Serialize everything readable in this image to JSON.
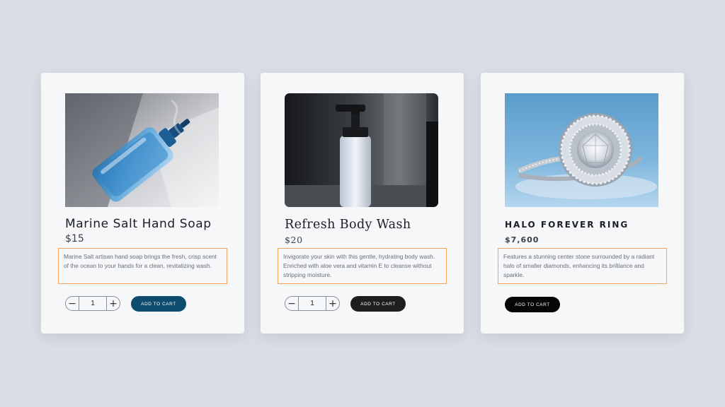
{
  "colors": {
    "page_bg": "#d9dde4",
    "card_bg": "#f6f7f9",
    "highlight_border": "#f0a35b",
    "soap_button": "#0e4c6e",
    "body_wash_button": "#1e1e1e",
    "ring_button": "#060606"
  },
  "products": [
    {
      "title": "Marine Salt Hand Soap",
      "price": "$15",
      "description": "Marine Salt artisan hand soap brings the fresh, crisp scent of the ocean to your hands for a clean, revitalizing wash.",
      "quantity": "1",
      "minus_label": "−",
      "plus_label": "+",
      "button_label": "ADD TO CART",
      "image_icon": "hand-soap-bottle-photo"
    },
    {
      "title": "Refresh Body Wash",
      "price": "$20",
      "description": "Invigorate your skin with this gentle, hydrating body wash. Enriched with aloe vera and vitamin E to cleanse without stripping moisture.",
      "quantity": "1",
      "minus_label": "−",
      "plus_label": "+",
      "button_label": "ADD TO CART",
      "image_icon": "pump-bottle-photo"
    },
    {
      "title": "HALO FOREVER RING",
      "price": "$7,600",
      "description": "Features a stunning center stone surrounded by a radiant halo of smaller diamonds, enhancing its brilliance and sparkle.",
      "button_label": "ADD TO CART",
      "image_icon": "diamond-ring-photo"
    }
  ]
}
